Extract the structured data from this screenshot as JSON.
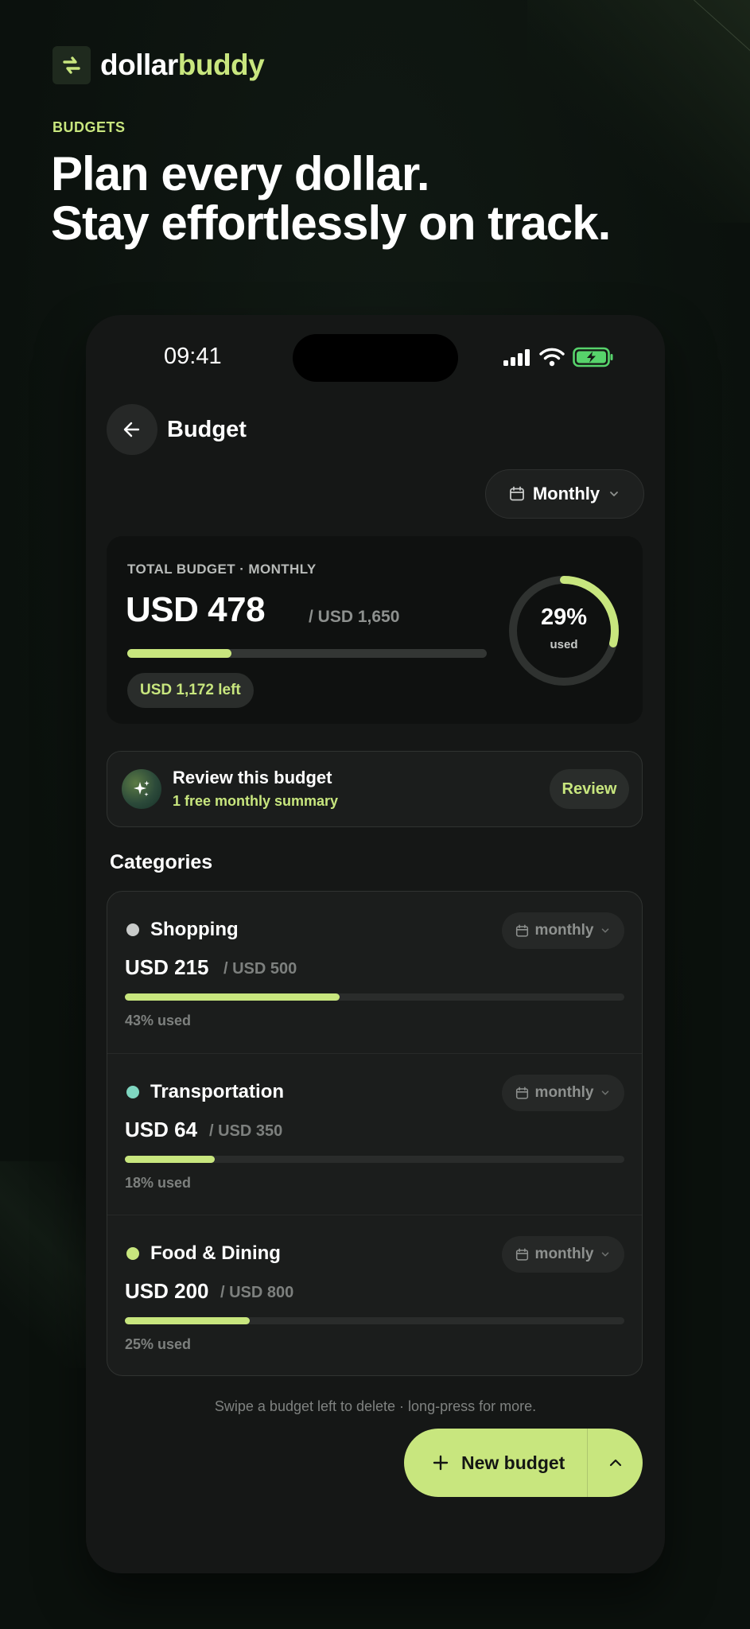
{
  "brand": {
    "name_part1": "dollar",
    "name_part2": "buddy",
    "accent_color": "#c8e67e",
    "logo_icon": "swap-arrows-icon"
  },
  "hero": {
    "eyebrow": "BUDGETS",
    "line1": "Plan every dollar.",
    "line2": "Stay effortlessly on track."
  },
  "status_bar": {
    "time": "09:41",
    "icons": [
      "signal-icon",
      "wifi-icon",
      "battery-charging-icon"
    ]
  },
  "header": {
    "back_icon": "arrow-left-icon",
    "title": "Budget"
  },
  "period_selector": {
    "label": "Monthly",
    "icon": "calendar-icon"
  },
  "total": {
    "label": "TOTAL BUDGET · MONTHLY",
    "amount": "USD 478",
    "of_total": "/ USD 1,650",
    "used_fraction": 0.29,
    "left_text": "USD 1,172 left",
    "percent_label": "29%",
    "used_label": "used"
  },
  "review": {
    "icon": "sparkles-icon",
    "title": "Review this budget",
    "subtitle": "1 free monthly summary",
    "button": "Review"
  },
  "categories_title": "Categories",
  "categories": [
    {
      "name": "Shopping",
      "dot_color": "#c9cbca",
      "period": "monthly",
      "amount": "USD 215",
      "of_total": "/ USD 500",
      "used_fraction": 0.43,
      "used_text": "43% used"
    },
    {
      "name": "Transportation",
      "dot_color": "#7fd6c0",
      "period": "monthly",
      "amount": "USD 64",
      "of_total": "/ USD 350",
      "used_fraction": 0.18,
      "used_text": "18% used"
    },
    {
      "name": "Food & Dining",
      "dot_color": "#c8e67e",
      "period": "monthly",
      "amount": "USD 200",
      "of_total": "/ USD 800",
      "used_fraction": 0.25,
      "used_text": "25% used"
    }
  ],
  "hint": "Swipe a budget left to delete · long-press for more.",
  "new_budget": {
    "label": "New budget",
    "icon": "plus-icon",
    "caret_icon": "chevron-up-icon"
  }
}
